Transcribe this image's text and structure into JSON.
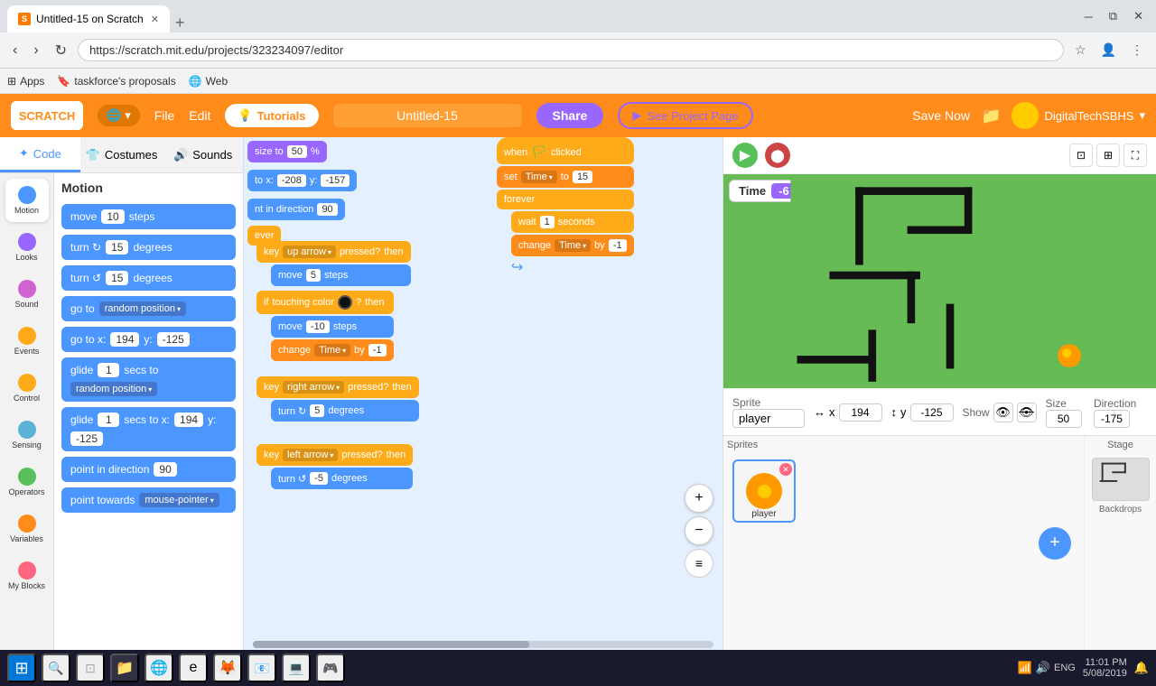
{
  "browser": {
    "tab_title": "Untitled-15 on Scratch",
    "tab_favicon": "S",
    "address": "https://scratch.mit.edu/projects/323234097/editor",
    "bookmarks": [
      {
        "label": "Apps",
        "icon": "grid"
      },
      {
        "label": "taskforce's proposals",
        "icon": "bookmark"
      },
      {
        "label": "Web",
        "icon": "globe"
      }
    ]
  },
  "scratch": {
    "logo": "SCRATCH",
    "globe_btn": "🌐",
    "menu": {
      "file": "File",
      "edit": "Edit",
      "tutorials_icon": "💡",
      "tutorials": "Tutorials"
    },
    "project_name": "Untitled-15",
    "share_btn": "Share",
    "see_project_icon": "▶",
    "see_project": "See Project Page",
    "save_now": "Save Now",
    "user": "DigitalTechSBHS"
  },
  "tabs": {
    "code": "Code",
    "costumes": "Costumes",
    "sounds": "Sounds"
  },
  "categories": [
    {
      "name": "Motion",
      "color": "#4c97ff",
      "label": "Motion"
    },
    {
      "name": "Looks",
      "color": "#9966ff",
      "label": "Looks"
    },
    {
      "name": "Sound",
      "color": "#cf63cf",
      "label": "Sound"
    },
    {
      "name": "Events",
      "color": "#ffab19",
      "label": "Events"
    },
    {
      "name": "Control",
      "color": "#ffab19",
      "label": "Control"
    },
    {
      "name": "Sensing",
      "color": "#5cb1d6",
      "label": "Sensing"
    },
    {
      "name": "Operators",
      "color": "#59c059",
      "label": "Operators"
    },
    {
      "name": "Variables",
      "color": "#ff8c1a",
      "label": "Variables"
    },
    {
      "name": "My Blocks",
      "color": "#ff6680",
      "label": "My Blocks"
    }
  ],
  "motion_category": "Motion",
  "blocks": [
    {
      "text": "move 10 steps"
    },
    {
      "text": "turn ↻ 15 degrees"
    },
    {
      "text": "turn ↺ 15 degrees"
    },
    {
      "text": "go to random position ▾"
    },
    {
      "text": "go to x: 194 y: -125"
    },
    {
      "text": "glide 1 secs to random position ▾"
    },
    {
      "text": "glide 1 secs to x: 194 y: -125"
    },
    {
      "text": "point in direction 90"
    },
    {
      "text": "point towards mouse-pointer ▾"
    }
  ],
  "stage": {
    "flag_color": "#59c059",
    "stop_color": "#cc4444",
    "timer_label": "Time",
    "timer_value": "-6",
    "sprite_label": "Sprite",
    "sprite_name": "player",
    "x_label": "x",
    "x_value": "194",
    "y_label": "y",
    "y_value": "-125",
    "show_label": "Show",
    "size_label": "Size",
    "size_value": "50",
    "direction_label": "Direction",
    "direction_value": "-175",
    "stage_label": "Stage",
    "backdrops_label": "Backdrops"
  },
  "taskbar": {
    "time": "11:01 PM",
    "date": "5/08/2019",
    "language": "ENG"
  },
  "canvas_blocks": {
    "group1_hat": "when 🏳 clicked",
    "group1_set": "set Time ▾ to 15",
    "group1_forever": "forever",
    "group1_wait": "wait 1 seconds",
    "group1_change": "change Time ▾ by -1",
    "size_block": "size to 50 %",
    "goto_block": "to x: -208 y: -157",
    "direction_block": "nt in direction 90",
    "ever_block": "ever",
    "key_up": "key up arrow ▾ pressed? then",
    "move_5": "move 5 steps",
    "touch_color": "if touching color 🔴 ? then",
    "move_neg10": "move -10 steps",
    "change_time": "change Time ▾ by -1",
    "key_right": "key right arrow ▾ pressed? then",
    "turn_5": "turn ↻ 5 degrees",
    "key_left": "key left arrow ▾ pressed? then",
    "turn_neg5": "turn ↺ -5 degrees"
  }
}
